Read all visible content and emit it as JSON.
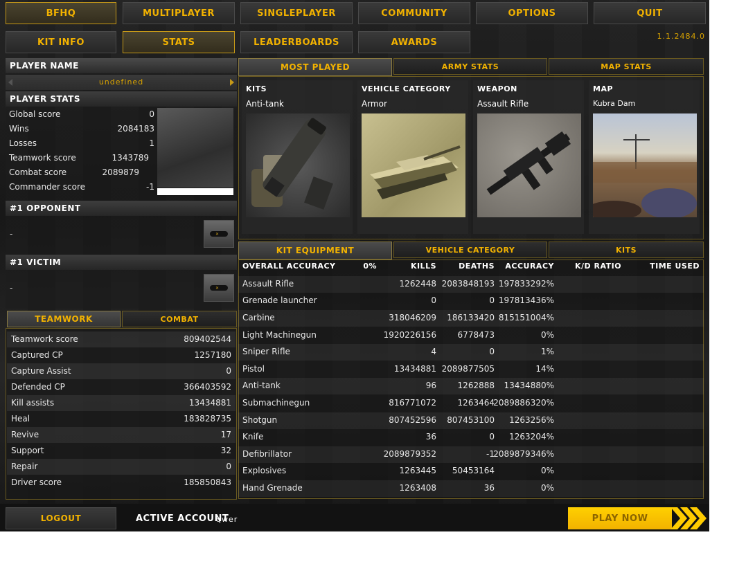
{
  "nav": {
    "top": [
      "BFHQ",
      "MULTIPLAYER",
      "SINGLEPLAYER",
      "COMMUNITY",
      "OPTIONS",
      "QUIT"
    ],
    "sub": [
      "KIT INFO",
      "STATS",
      "LEADERBOARDS",
      "AWARDS"
    ]
  },
  "version": "1.1.2484.0",
  "player": {
    "name_header": "PLAYER NAME",
    "name_value": "undefined",
    "stats_header": "PLAYER STATS",
    "stats": [
      {
        "label": "Global score",
        "value": "0"
      },
      {
        "label": "Wins",
        "value": "2084183"
      },
      {
        "label": "Losses",
        "value": "1"
      },
      {
        "label": "Teamwork score",
        "value": "1343789"
      },
      {
        "label": "Combat score",
        "value": "2089879"
      },
      {
        "label": "Commander score",
        "value": "-1"
      }
    ],
    "opponent_header": "#1 OPPONENT",
    "opponent_value": "-",
    "victim_header": "#1 VICTIM",
    "victim_value": "-"
  },
  "teamwork": {
    "tabs": [
      "TEAMWORK",
      "COMBAT"
    ],
    "rows": [
      {
        "label": "Teamwork score",
        "value": "809402544"
      },
      {
        "label": "Captured CP",
        "value": "1257180"
      },
      {
        "label": "Capture Assist",
        "value": "0"
      },
      {
        "label": "Defended CP",
        "value": "366403592"
      },
      {
        "label": "Kill assists",
        "value": "13434881"
      },
      {
        "label": "Heal",
        "value": "183828735"
      },
      {
        "label": "Revive",
        "value": "17"
      },
      {
        "label": "Support",
        "value": "32"
      },
      {
        "label": "Repair",
        "value": "0"
      },
      {
        "label": "Driver score",
        "value": "185850843"
      }
    ]
  },
  "most_played": {
    "tabs": [
      "MOST PLAYED",
      "ARMY STATS",
      "MAP STATS"
    ],
    "cards": [
      {
        "title": "KITS",
        "value": "Anti-tank"
      },
      {
        "title": "VEHICLE CATEGORY",
        "value": "Armor"
      },
      {
        "title": "WEAPON",
        "value": "Assault Rifle"
      },
      {
        "title": "MAP",
        "value": "Kubra Dam"
      }
    ]
  },
  "equipment": {
    "tabs": [
      "KIT EQUIPMENT",
      "VEHICLE CATEGORY",
      "KITS"
    ],
    "headers": [
      "OVERALL ACCURACY",
      "0%",
      "KILLS",
      "DEATHS",
      "ACCURACY",
      "K/D RATIO",
      "TIME USED"
    ],
    "rows": [
      {
        "name": "Assault Rifle",
        "kills": "1262448",
        "deaths": "2083848193",
        "accuracy": "197833292%"
      },
      {
        "name": "Grenade launcher",
        "kills": "0",
        "deaths": "0",
        "accuracy": "197813436%"
      },
      {
        "name": "Carbine",
        "kills": "318046209",
        "deaths": "186133420",
        "accuracy": "815151004%"
      },
      {
        "name": "Light Machinegun",
        "kills": "1920226156",
        "deaths": "6778473",
        "accuracy": "0%"
      },
      {
        "name": "Sniper Rifle",
        "kills": "4",
        "deaths": "0",
        "accuracy": "1%"
      },
      {
        "name": "Pistol",
        "kills": "13434881",
        "deaths": "2089877505",
        "accuracy": "14%"
      },
      {
        "name": "Anti-tank",
        "kills": "96",
        "deaths": "1262888",
        "accuracy": "13434880%"
      },
      {
        "name": "Submachinegun",
        "kills": "816771072",
        "deaths": "1263464",
        "accuracy": "2089886320%"
      },
      {
        "name": "Shotgun",
        "kills": "807452596",
        "deaths": "807453100",
        "accuracy": "1263256%"
      },
      {
        "name": "Knife",
        "kills": "36",
        "deaths": "0",
        "accuracy": "1263204%"
      },
      {
        "name": "Defibrillator",
        "kills": "2089879352",
        "deaths": "-1",
        "accuracy": "2089879346%"
      },
      {
        "name": "Explosives",
        "kills": "1263445",
        "deaths": "50453164",
        "accuracy": "0%"
      },
      {
        "name": "Hand Grenade",
        "kills": "1263408",
        "deaths": "36",
        "accuracy": "0%"
      }
    ]
  },
  "footer": {
    "logout": "LOGOUT",
    "active_account_label": "ACTIVE ACCOUNT",
    "account": "qwer",
    "play_now": "PLAY NOW"
  },
  "colors": {
    "accent": "#f2b200",
    "play_button": "#ffcc00"
  }
}
